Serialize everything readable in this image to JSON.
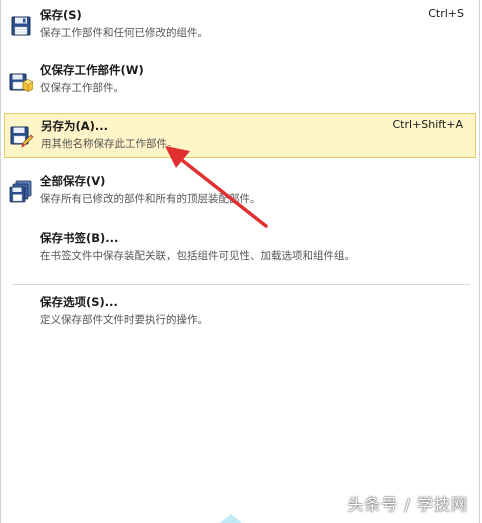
{
  "menu": {
    "items": [
      {
        "id": "save",
        "label": "保存(S)",
        "description": "保存工作部件和任何已修改的组件。",
        "shortcut": "Ctrl+S",
        "icon": "floppy-disk-icon"
      },
      {
        "id": "save-work-part-only",
        "label": "仅保存工作部件(W)",
        "description": "仅保存工作部件。",
        "shortcut": "",
        "icon": "floppy-part-icon"
      },
      {
        "id": "save-as",
        "label": "另存为(A)...",
        "description": "用其他名称保存此工作部件。",
        "shortcut": "Ctrl+Shift+A",
        "icon": "floppy-pencil-icon"
      },
      {
        "id": "save-all",
        "label": "全部保存(V)",
        "description": "保存所有已修改的部件和所有的顶层装配部件。",
        "shortcut": "",
        "icon": "multiple-floppy-icon"
      },
      {
        "id": "save-bookmark",
        "label": "保存书签(B)...",
        "description": "在书签文件中保存装配关联，包括组件可见性、加载选项和组件组。",
        "shortcut": "",
        "icon": ""
      },
      {
        "id": "save-options",
        "label": "保存选项(S)...",
        "description": "定义保存部件文件时要执行的操作。",
        "shortcut": "",
        "icon": ""
      }
    ]
  },
  "watermark": "头条号 / 学技网",
  "colors": {
    "highlight_bg": "#fdf4c7",
    "highlight_border": "#e8c96a",
    "arrow": "#e03030"
  }
}
